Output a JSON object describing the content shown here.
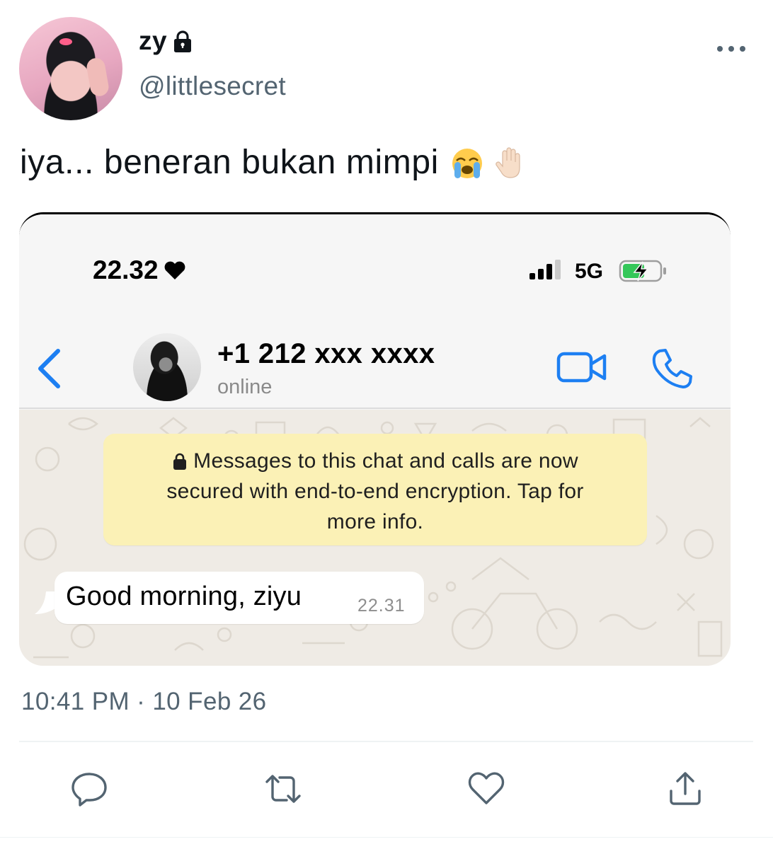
{
  "author": {
    "display_name": "zy",
    "handle": "@littlesecret"
  },
  "tweet": {
    "text": "iya... beneran bukan mimpi",
    "emojis": [
      "loudly-crying-face",
      "raised-hand-light-skin"
    ],
    "timestamp": "10:41 PM · 10 Feb 26"
  },
  "screenshot": {
    "status_bar": {
      "time": "22.32",
      "network": "5G"
    },
    "chat_header": {
      "contact_name": "+1 212 xxx xxxx",
      "contact_status": "online"
    },
    "encryption_notice": {
      "line1": "Messages to this chat and calls are now",
      "line2": "secured with end-to-end encryption. Tap for",
      "line3": "more info."
    },
    "message": {
      "text": "Good morning, ziyu",
      "time": "22.31"
    }
  },
  "actions": [
    "reply-icon",
    "retweet-icon",
    "like-icon",
    "share-icon"
  ],
  "colors": {
    "text": "#0f1419",
    "secondary": "#536471",
    "whatsapp_blue": "#1d7ff2",
    "banner": "#fbf1b6",
    "chat_bg": "#efebe5",
    "battery_green": "#34c759"
  }
}
